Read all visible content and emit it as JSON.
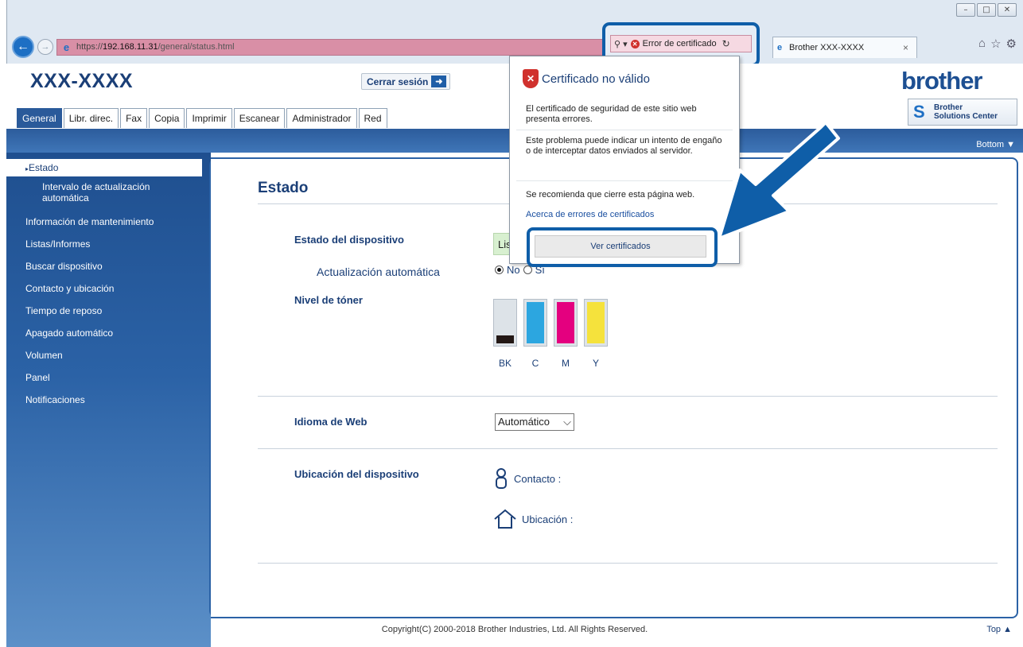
{
  "browser": {
    "url_protocol": "https://",
    "url_host": "192.168.11.31",
    "url_path": "/general/status.html",
    "cert_error_label": "Error de certificado",
    "tab_title": "Brother XXX-XXXX",
    "window_controls": [
      "–",
      "□",
      "✕"
    ]
  },
  "header": {
    "model": "XXX-XXXX",
    "logout_label": "Cerrar sesión",
    "brand": "brother",
    "solutions_line1": "Brother",
    "solutions_line2": "Solutions Center"
  },
  "tabs": [
    {
      "label": "General",
      "active": true
    },
    {
      "label": "Libr. direc."
    },
    {
      "label": "Fax"
    },
    {
      "label": "Copia"
    },
    {
      "label": "Imprimir"
    },
    {
      "label": "Escanear"
    },
    {
      "label": "Administrador"
    },
    {
      "label": "Red"
    }
  ],
  "bottom_link": "Bottom ▼",
  "sidebar": {
    "items": [
      {
        "label": "Estado",
        "active": true
      },
      {
        "label": "Intervalo de actualización",
        "label2": "automática"
      },
      {
        "label": "Información de mantenimiento"
      },
      {
        "label": "Listas/Informes"
      },
      {
        "label": "Buscar dispositivo"
      },
      {
        "label": "Contacto y ubicación"
      },
      {
        "label": "Tiempo de reposo"
      },
      {
        "label": "Apagado automático"
      },
      {
        "label": "Volumen"
      },
      {
        "label": "Panel"
      },
      {
        "label": "Notificaciones"
      }
    ]
  },
  "main": {
    "title": "Estado",
    "device_status_label": "Estado del dispositivo",
    "device_status_value": "Lis",
    "auto_update_label": "Actualización automática",
    "radio_no": "No",
    "radio_si": "Sí",
    "toner_label": "Nivel de tóner",
    "toner": [
      {
        "name": "BK",
        "color": "#231815",
        "level": 0.2
      },
      {
        "name": "C",
        "color": "#2ca6e0",
        "level": 1.0
      },
      {
        "name": "M",
        "color": "#e4007f",
        "level": 1.0
      },
      {
        "name": "Y",
        "color": "#f5e23c",
        "level": 1.0
      }
    ],
    "web_lang_label": "Idioma de Web",
    "web_lang_value": "Automático",
    "location_label": "Ubicación del dispositivo",
    "contact_label": "Contacto :",
    "location_value_label": "Ubicación :"
  },
  "footer": {
    "copyright": "Copyright(C) 2000-2018 Brother Industries, Ltd. All Rights Reserved.",
    "top_link": "Top ▲"
  },
  "popup": {
    "title": "Certificado no válido",
    "para1": "El certificado de seguridad de este sitio web presenta errores.",
    "para2": "Este problema puede indicar un intento de engaño o de interceptar datos enviados al servidor.",
    "para3": "Se recomienda que cierre esta página web.",
    "link": "Acerca de errores de certificados",
    "button": "Ver certificados"
  }
}
